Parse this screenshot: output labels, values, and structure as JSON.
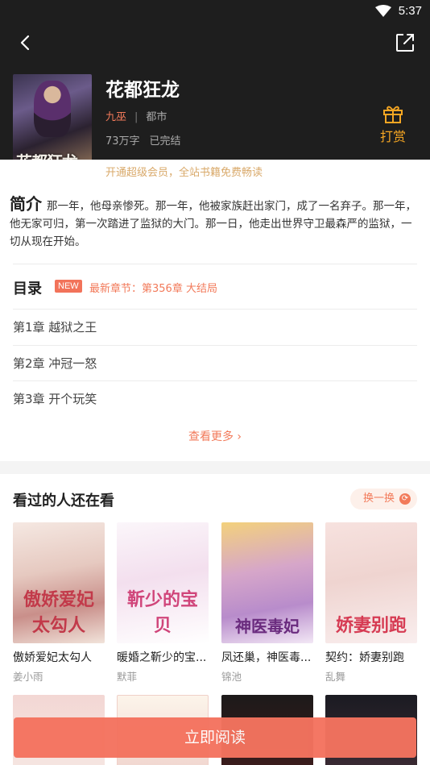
{
  "status": {
    "time": "5:37"
  },
  "book": {
    "title": "花都狂龙",
    "cover_title": "花都狂龙",
    "author": "九巫",
    "category": "都市",
    "word_count": "73万字",
    "status": "已完结",
    "reward_label": "打赏",
    "vip_promo": "开通超级会员，全站书籍免费畅读"
  },
  "intro": {
    "heading": "简介",
    "text": "那一年，他母亲惨死。那一年，他被家族赶出家门，成了一名弃子。那一年，他无家可归，第一次踏进了监狱的大门。那一日，他走出世界守卫最森严的监狱，一切从现在开始。"
  },
  "toc": {
    "heading": "目录",
    "new_badge": "NEW",
    "latest": "最新章节：第356章 大结局",
    "chapters": [
      "第1章 越狱之王",
      "第2章 冲冠一怒",
      "第3章 开个玩笑"
    ],
    "more": "查看更多"
  },
  "recommend": {
    "heading": "看过的人还在看",
    "swap_label": "换一换",
    "books": [
      {
        "title": "傲娇爱妃太勾人",
        "author": "姜小雨",
        "cover_text": "傲娇爱妃太勾人"
      },
      {
        "title": "暖婚之靳少的宝...",
        "author": "默菲",
        "cover_text": "靳少的宝贝"
      },
      {
        "title": "凤还巢，神医毒...",
        "author": "锦池",
        "cover_text": "神医毒妃"
      },
      {
        "title": "契约：娇妻别跑",
        "author": "乱舞",
        "cover_text": "娇妻别跑"
      }
    ]
  },
  "footer": {
    "read_label": "立即阅读"
  }
}
